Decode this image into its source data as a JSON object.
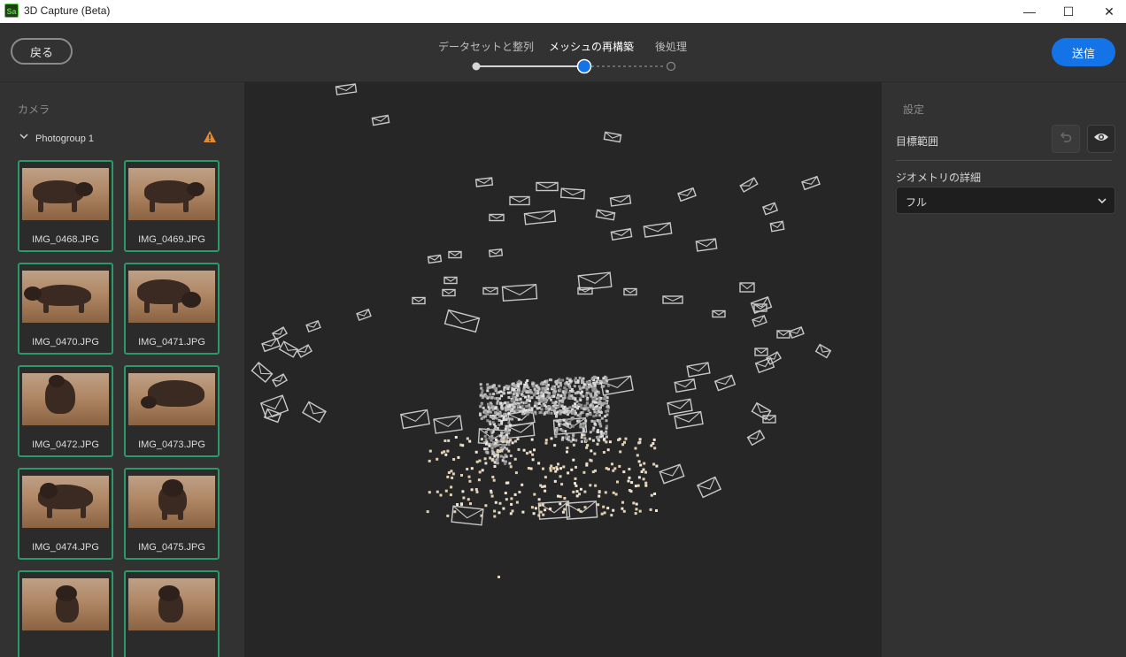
{
  "window": {
    "logo_text": "Sa",
    "title": "3D Capture (Beta)",
    "minimize_glyph": "—",
    "maximize_glyph": "☐",
    "close_glyph": "✕"
  },
  "header": {
    "back_label": "戻る",
    "steps": [
      {
        "label": "データセットと整列",
        "state": "done"
      },
      {
        "label": "メッシュの再構築",
        "state": "current"
      },
      {
        "label": "後処理",
        "state": "upcoming"
      }
    ],
    "submit_label": "送信",
    "accent_color": "#1473e6"
  },
  "left_panel": {
    "section_title": "カメラ",
    "group_name": "Photogroup 1",
    "group_warning_icon": "warning-icon",
    "thumbnails": [
      {
        "file": "IMG_0468.JPG"
      },
      {
        "file": "IMG_0469.JPG"
      },
      {
        "file": "IMG_0470.JPG"
      },
      {
        "file": "IMG_0471.JPG"
      },
      {
        "file": "IMG_0472.JPG"
      },
      {
        "file": "IMG_0473.JPG"
      },
      {
        "file": "IMG_0474.JPG"
      },
      {
        "file": "IMG_0475.JPG"
      },
      {
        "file": ""
      },
      {
        "file": ""
      }
    ]
  },
  "right_panel": {
    "section_title": "設定",
    "target_area_label": "目標範囲",
    "geometry_detail_label": "ジオメトリの詳細",
    "geometry_detail_value": "フル"
  }
}
